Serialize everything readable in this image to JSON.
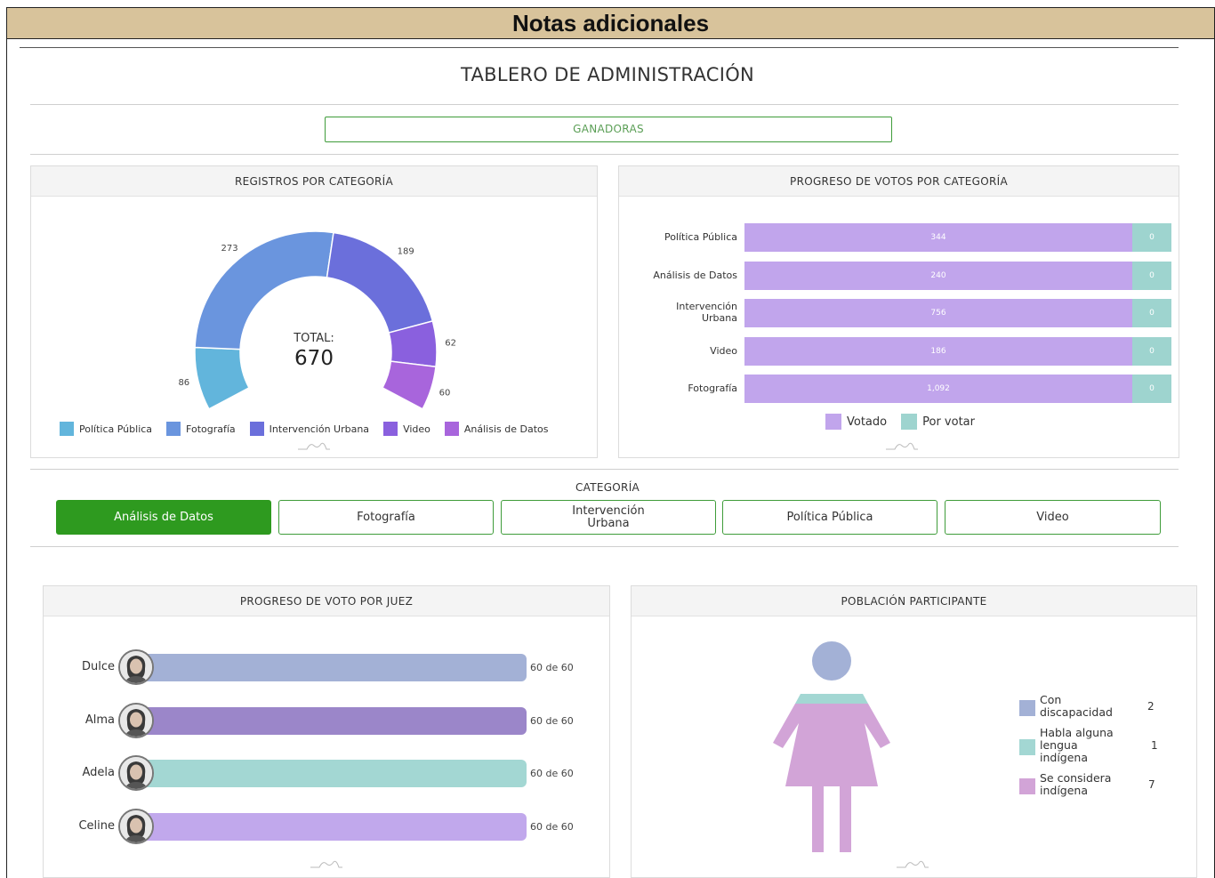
{
  "banner": {
    "title": "Notas adicionales"
  },
  "header": {
    "title": "TABLERO DE ADMINISTRACIÓN",
    "winners_button": "GANADORAS"
  },
  "registros": {
    "title": "REGISTROS POR CATEGORÍA",
    "total_label": "TOTAL:",
    "total_value": "670",
    "chart_data": {
      "type": "pie",
      "title": "REGISTROS POR CATEGORÍA",
      "slices": [
        {
          "name": "Política Pública",
          "value": 86,
          "color": "#62b5dc"
        },
        {
          "name": "Fotografía",
          "value": 273,
          "color": "#6a95de"
        },
        {
          "name": "Intervención Urbana",
          "value": 189,
          "color": "#6b6fdb"
        },
        {
          "name": "Video",
          "value": 62,
          "color": "#8a60de"
        },
        {
          "name": "Análisis de Datos",
          "value": 60,
          "color": "#a865dc"
        }
      ]
    },
    "legend": [
      {
        "label": "Política Pública",
        "color": "#62b5dc"
      },
      {
        "label": "Fotografía",
        "color": "#6a95de"
      },
      {
        "label": "Intervención Urbana",
        "color": "#6b6fdb"
      },
      {
        "label": "Video",
        "color": "#8a60de"
      },
      {
        "label": "Análisis de Datos",
        "color": "#a865dc"
      }
    ]
  },
  "progreso_categoria": {
    "title": "PROGRESO DE VOTOS POR CATEGORÍA",
    "chart_data": {
      "type": "bar",
      "orientation": "horizontal",
      "stacked": true,
      "categories": [
        "Política Pública",
        "Análisis de Datos",
        "Intervención Urbana",
        "Video",
        "Fotografía"
      ],
      "series": [
        {
          "name": "Votado",
          "values": [
            344,
            240,
            756,
            186,
            1092
          ],
          "labels": [
            "344",
            "240",
            "756",
            "186",
            "1,092"
          ],
          "color": "#c1a5ec"
        },
        {
          "name": "Por votar",
          "values": [
            0,
            0,
            0,
            0,
            0
          ],
          "labels": [
            "0",
            "0",
            "0",
            "0",
            "0"
          ],
          "color": "#9ed4cf"
        }
      ]
    },
    "legend": [
      {
        "label": "Votado",
        "color": "#c1a5ec"
      },
      {
        "label": "Por votar",
        "color": "#9ed4cf"
      }
    ]
  },
  "categoria": {
    "title": "CATEGORÍA",
    "tabs": [
      {
        "label": "Análisis de Datos",
        "active": true
      },
      {
        "label": "Fotografía",
        "active": false
      },
      {
        "label": "Intervención Urbana",
        "active": false
      },
      {
        "label": "Política Pública",
        "active": false
      },
      {
        "label": "Video",
        "active": false
      }
    ]
  },
  "progreso_juez": {
    "title": "PROGRESO DE VOTO POR JUEZ",
    "judges": [
      {
        "name": "Dulce",
        "voted": 60,
        "total": 60,
        "count_label": "60 de 60",
        "color": "#a3b1d6"
      },
      {
        "name": "Alma",
        "voted": 60,
        "total": 60,
        "count_label": "60 de 60",
        "color": "#9b86c9"
      },
      {
        "name": "Adela",
        "voted": 60,
        "total": 60,
        "count_label": "60 de 60",
        "color": "#a3d7d3"
      },
      {
        "name": "Celine",
        "voted": 60,
        "total": 60,
        "count_label": "60 de 60",
        "color": "#c1a8ec"
      }
    ]
  },
  "poblacion": {
    "title": "POBLACIÓN PARTICIPANTE",
    "items": [
      {
        "label": "Con discapacidad",
        "value": "2",
        "color": "#a3b1d6"
      },
      {
        "label": "Habla alguna lengua indígena",
        "value": "1",
        "color": "#a3d7d3"
      },
      {
        "label": "Se considera indígena",
        "value": "7",
        "color": "#d2a4d7"
      }
    ]
  }
}
